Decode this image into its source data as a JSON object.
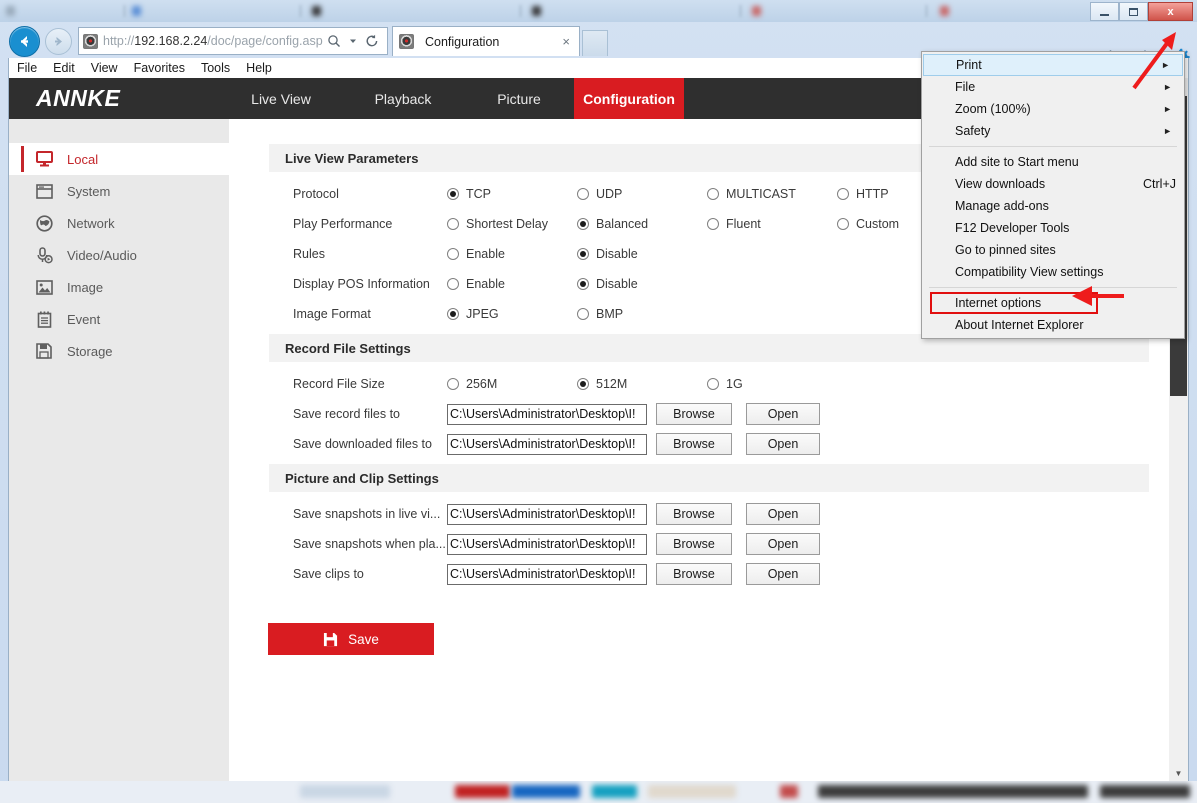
{
  "window": {
    "minimize_label": "Minimize",
    "maximize_label": "Maximize",
    "close_label": "x"
  },
  "browser": {
    "back_label": "Back",
    "forward_label": "Forward",
    "address_prefix": "http://",
    "address_host": "192.168.2.24",
    "address_path": "/doc/page/config.asp",
    "search_icon": "search-icon",
    "refresh_icon": "refresh-icon",
    "tab_title": "Configuration",
    "tab_close": "×",
    "home_icon": "home-icon",
    "favorites_icon": "star-icon",
    "tools_icon": "gear-icon",
    "menubar": [
      "File",
      "Edit",
      "View",
      "Favorites",
      "Tools",
      "Help"
    ]
  },
  "ie_menu": {
    "items": [
      {
        "label": "Print",
        "submenu": true,
        "accel": "",
        "highlighted": true
      },
      {
        "label": "File",
        "submenu": true,
        "accel": ""
      },
      {
        "label": "Zoom (100%)",
        "submenu": true,
        "accel": ""
      },
      {
        "label": "Safety",
        "submenu": true,
        "accel": ""
      },
      {
        "label": "Add site to Start menu",
        "submenu": false,
        "accel": ""
      },
      {
        "label": "View downloads",
        "submenu": false,
        "accel": "Ctrl+J"
      },
      {
        "label": "Manage add-ons",
        "submenu": false,
        "accel": ""
      },
      {
        "label": "F12 Developer Tools",
        "submenu": false,
        "accel": ""
      },
      {
        "label": "Go to pinned sites",
        "submenu": false,
        "accel": ""
      },
      {
        "label": "Compatibility View settings",
        "submenu": false,
        "accel": ""
      },
      {
        "label": "Internet options",
        "submenu": false,
        "accel": "",
        "boxed": true
      },
      {
        "label": "About Internet Explorer",
        "submenu": false,
        "accel": ""
      }
    ],
    "separator_after_index": [
      3,
      9
    ]
  },
  "app": {
    "logo": "ANNKE",
    "nav": [
      {
        "label": "Live View",
        "active": false
      },
      {
        "label": "Playback",
        "active": false
      },
      {
        "label": "Picture",
        "active": false
      },
      {
        "label": "Configuration",
        "active": true
      }
    ],
    "sidebar": [
      {
        "label": "Local",
        "icon": "monitor-icon",
        "active": true
      },
      {
        "label": "System",
        "icon": "window-icon",
        "active": false
      },
      {
        "label": "Network",
        "icon": "globe-icon",
        "active": false
      },
      {
        "label": "Video/Audio",
        "icon": "microphone-icon",
        "active": false
      },
      {
        "label": "Image",
        "icon": "picture-icon",
        "active": false
      },
      {
        "label": "Event",
        "icon": "clipboard-icon",
        "active": false
      },
      {
        "label": "Storage",
        "icon": "floppy-disk-icon",
        "active": false
      }
    ],
    "sections": {
      "live_view": {
        "title": "Live View Parameters",
        "rows": [
          {
            "label": "Protocol",
            "options": [
              {
                "label": "TCP",
                "selected": true
              },
              {
                "label": "UDP",
                "selected": false
              },
              {
                "label": "MULTICAST",
                "selected": false
              },
              {
                "label": "HTTP",
                "selected": false
              }
            ]
          },
          {
            "label": "Play Performance",
            "options": [
              {
                "label": "Shortest Delay",
                "selected": false
              },
              {
                "label": "Balanced",
                "selected": true
              },
              {
                "label": "Fluent",
                "selected": false
              },
              {
                "label": "Custom",
                "selected": false
              }
            ]
          },
          {
            "label": "Rules",
            "options": [
              {
                "label": "Enable",
                "selected": false
              },
              {
                "label": "Disable",
                "selected": true
              }
            ]
          },
          {
            "label": "Display POS Information",
            "options": [
              {
                "label": "Enable",
                "selected": false
              },
              {
                "label": "Disable",
                "selected": true
              }
            ]
          },
          {
            "label": "Image Format",
            "options": [
              {
                "label": "JPEG",
                "selected": true
              },
              {
                "label": "BMP",
                "selected": false
              }
            ]
          }
        ]
      },
      "record_file": {
        "title": "Record File Settings",
        "size_row": {
          "label": "Record File Size",
          "options": [
            {
              "label": "256M",
              "selected": false
            },
            {
              "label": "512M",
              "selected": true
            },
            {
              "label": "1G",
              "selected": false
            }
          ]
        },
        "paths": [
          {
            "label": "Save record files to",
            "value": "C:\\Users\\Administrator\\Desktop\\I!",
            "browse_label": "Browse",
            "open_label": "Open"
          },
          {
            "label": "Save downloaded files to",
            "value": "C:\\Users\\Administrator\\Desktop\\I!",
            "browse_label": "Browse",
            "open_label": "Open"
          }
        ]
      },
      "picture_clip": {
        "title": "Picture and Clip Settings",
        "paths": [
          {
            "label": "Save snapshots in live vi...",
            "value": "C:\\Users\\Administrator\\Desktop\\I!",
            "browse_label": "Browse",
            "open_label": "Open"
          },
          {
            "label": "Save snapshots when pla...",
            "value": "C:\\Users\\Administrator\\Desktop\\I!",
            "browse_label": "Browse",
            "open_label": "Open"
          },
          {
            "label": "Save clips to",
            "value": "C:\\Users\\Administrator\\Desktop\\I!",
            "browse_label": "Browse",
            "open_label": "Open"
          }
        ]
      }
    },
    "save_button": {
      "label": "Save",
      "icon": "floppy-disk-icon",
      "color": "#d91c21"
    }
  },
  "annotations": {
    "arrow_to_gear": "red-arrow-pointing-to-gear-icon",
    "arrow_to_internet_options": "red-arrow-pointing-to-internet-options",
    "highlight_color": "#e10f0f"
  }
}
